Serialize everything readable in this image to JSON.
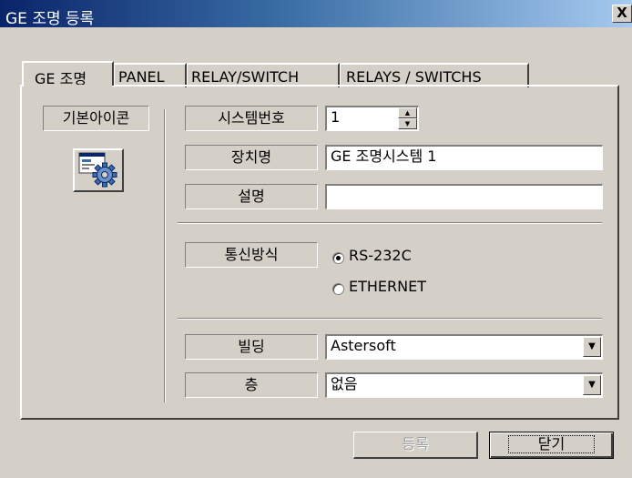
{
  "window": {
    "title": "GE 조명 등록",
    "close_glyph": "X"
  },
  "tabs": [
    {
      "label": "GE 조명",
      "selected": true
    },
    {
      "label": "PANEL",
      "selected": false
    },
    {
      "label": "RELAY/SWITCH",
      "selected": false
    },
    {
      "label": "RELAYS / SWITCHS",
      "selected": false
    }
  ],
  "icon_panel": {
    "label": "기본아이콘",
    "icon": "gear-settings-icon"
  },
  "form": {
    "system_number": {
      "label": "시스템번호",
      "value": "1"
    },
    "device_name": {
      "label": "장치명",
      "value": "GE 조명시스템 1"
    },
    "description": {
      "label": "설명",
      "value": ""
    },
    "comm_method": {
      "label": "통신방식",
      "options": [
        {
          "label": "RS-232C",
          "checked": true
        },
        {
          "label": "ETHERNET",
          "checked": false
        }
      ]
    },
    "building": {
      "label": "빌딩",
      "value": "Astersoft"
    },
    "floor": {
      "label": "층",
      "value": "없음"
    }
  },
  "buttons": {
    "register": "등록",
    "close": "닫기"
  },
  "colors": {
    "face": "#d4d0c8",
    "title_start": "#0a246a",
    "title_end": "#a6caf0"
  }
}
